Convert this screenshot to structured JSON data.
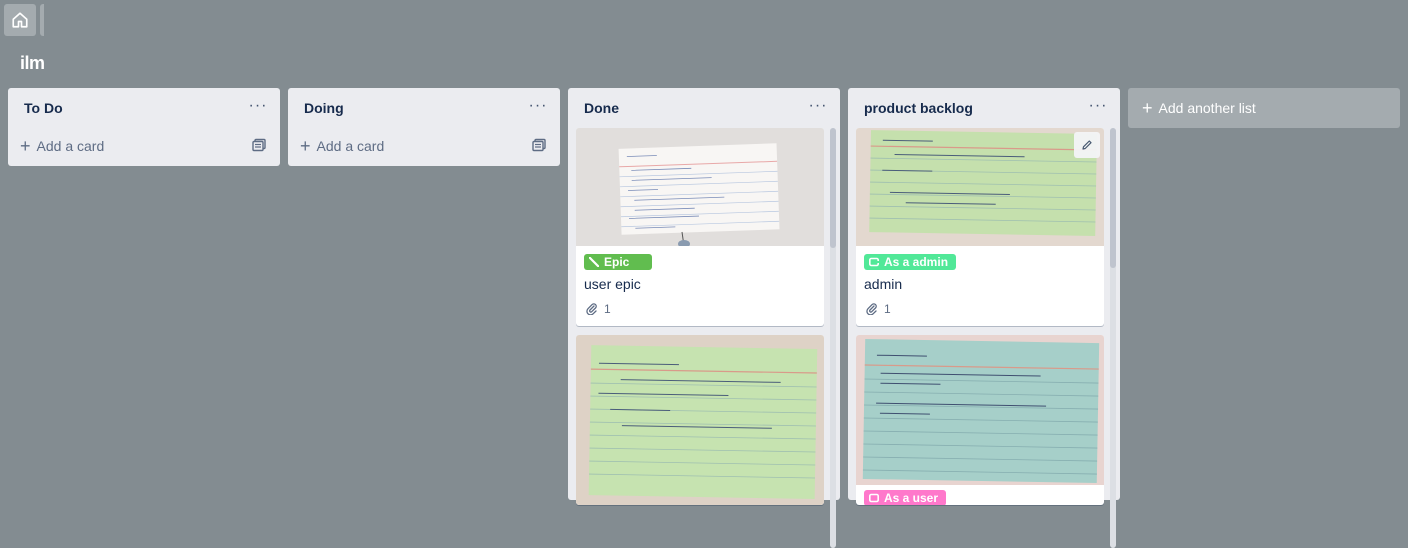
{
  "board": {
    "title": "ilm",
    "home_icon": "home-icon"
  },
  "lists": [
    {
      "title": "To Do",
      "menu": "···",
      "add_card": "Add a card"
    },
    {
      "title": "Doing",
      "menu": "···",
      "add_card": "Add a card"
    },
    {
      "title": "Done",
      "menu": "···",
      "cards": [
        {
          "label": "Epic",
          "label_color": "#61bd4f",
          "title": "user epic",
          "attachments": "1"
        },
        {
          "cover": "As a instructor note card"
        }
      ]
    },
    {
      "title": "product backlog",
      "menu": "···",
      "cards": [
        {
          "label": "As a admin",
          "label_color": "#51e898",
          "title": "admin",
          "attachments": "1"
        },
        {
          "label": "As a user",
          "label_color": "#ff78cb"
        }
      ]
    }
  ],
  "add_list": "Add another list",
  "colors": {
    "background": "#838c91",
    "list_bg": "#ebecf0",
    "epic_label": "#61bd4f",
    "admin_label": "#51e898",
    "user_label": "#ff78cb"
  }
}
